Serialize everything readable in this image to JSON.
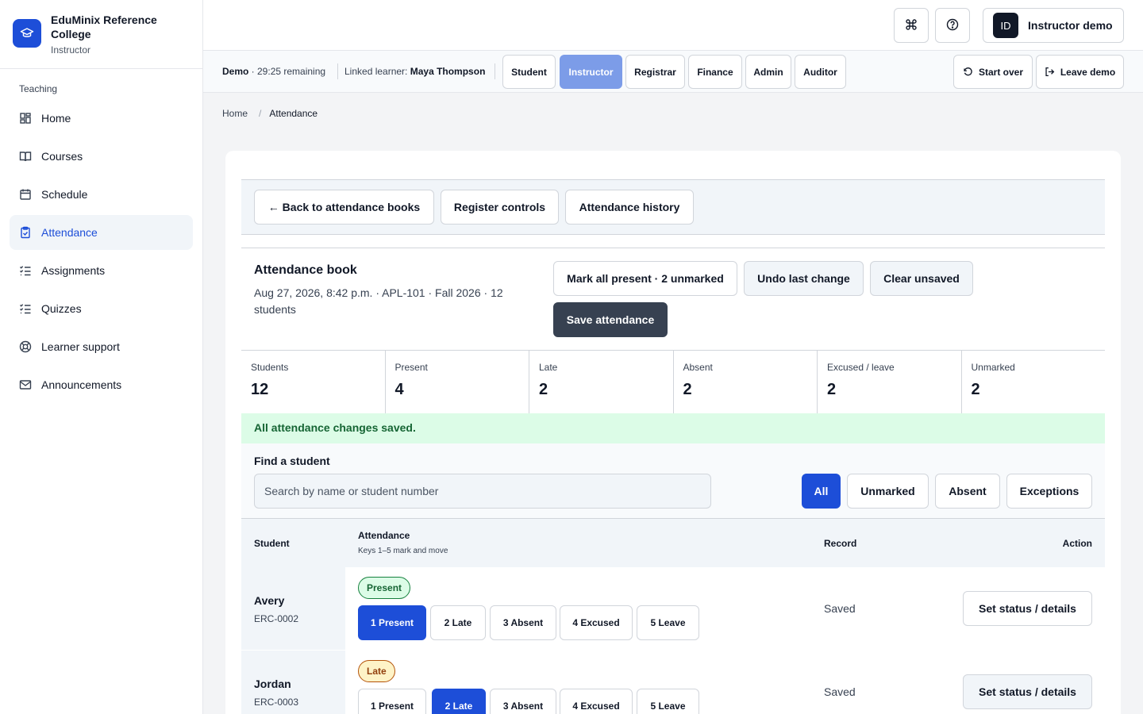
{
  "brand": {
    "name": "EduMinix Reference College",
    "role": "Instructor"
  },
  "sidebar": {
    "section": "Teaching",
    "items": [
      {
        "label": "Home",
        "icon": "home-grid-icon",
        "active": false
      },
      {
        "label": "Courses",
        "icon": "book-open-icon",
        "active": false
      },
      {
        "label": "Schedule",
        "icon": "calendar-icon",
        "active": false
      },
      {
        "label": "Attendance",
        "icon": "clipboard-check-icon",
        "active": true
      },
      {
        "label": "Assignments",
        "icon": "list-check-icon",
        "active": false
      },
      {
        "label": "Quizzes",
        "icon": "list-check-icon",
        "active": false
      },
      {
        "label": "Learner support",
        "icon": "lifebuoy-icon",
        "active": false
      },
      {
        "label": "Announcements",
        "icon": "mail-icon",
        "active": false
      }
    ]
  },
  "header": {
    "user_initials": "ID",
    "user_name": "Instructor demo"
  },
  "demo": {
    "label": "Demo",
    "remaining": " · 29:25 remaining",
    "linked_prefix": "Linked learner: ",
    "linked_name": "Maya Thompson",
    "roles": [
      "Student",
      "Instructor",
      "Registrar",
      "Finance",
      "Admin",
      "Auditor"
    ],
    "active_role": "Instructor",
    "start_over": "Start over",
    "leave": "Leave demo"
  },
  "breadcrumb": {
    "home": "Home",
    "sep": "/",
    "current": "Attendance"
  },
  "toolbar": {
    "back": "← Back to attendance books",
    "register_controls": "Register controls",
    "history": "Attendance history"
  },
  "book": {
    "title": "Attendance book",
    "meta": "Aug 27, 2026, 8:42 p.m. · APL-101 · Fall 2026 · 12 students",
    "mark_all": "Mark all present · 2 unmarked",
    "undo": "Undo last change",
    "clear": "Clear unsaved",
    "save": "Save attendance"
  },
  "stats": [
    {
      "label": "Students",
      "value": "12"
    },
    {
      "label": "Present",
      "value": "4"
    },
    {
      "label": "Late",
      "value": "2"
    },
    {
      "label": "Absent",
      "value": "2"
    },
    {
      "label": "Excused / leave",
      "value": "2"
    },
    {
      "label": "Unmarked",
      "value": "2"
    }
  ],
  "status_message": "All attendance changes saved.",
  "filter": {
    "label": "Find a student",
    "placeholder": "Search by name or student number",
    "chips": [
      "All",
      "Unmarked",
      "Absent",
      "Exceptions"
    ],
    "active_chip": "All"
  },
  "table": {
    "col_student": "Student",
    "col_attendance": "Attendance",
    "col_attendance_hint": "Keys 1–5 mark and move",
    "col_record": "Record",
    "col_action": "Action",
    "options": [
      "1 Present",
      "2 Late",
      "3 Absent",
      "4 Excused",
      "5 Leave"
    ],
    "rows": [
      {
        "name": "Avery",
        "number": "ERC-0002",
        "badge": "Present",
        "selected": 0,
        "record": "Saved",
        "action": "Set status / details"
      },
      {
        "name": "Jordan",
        "number": "ERC-0003",
        "badge": "Late",
        "selected": 1,
        "record": "Saved",
        "action": "Set status / details"
      }
    ]
  }
}
